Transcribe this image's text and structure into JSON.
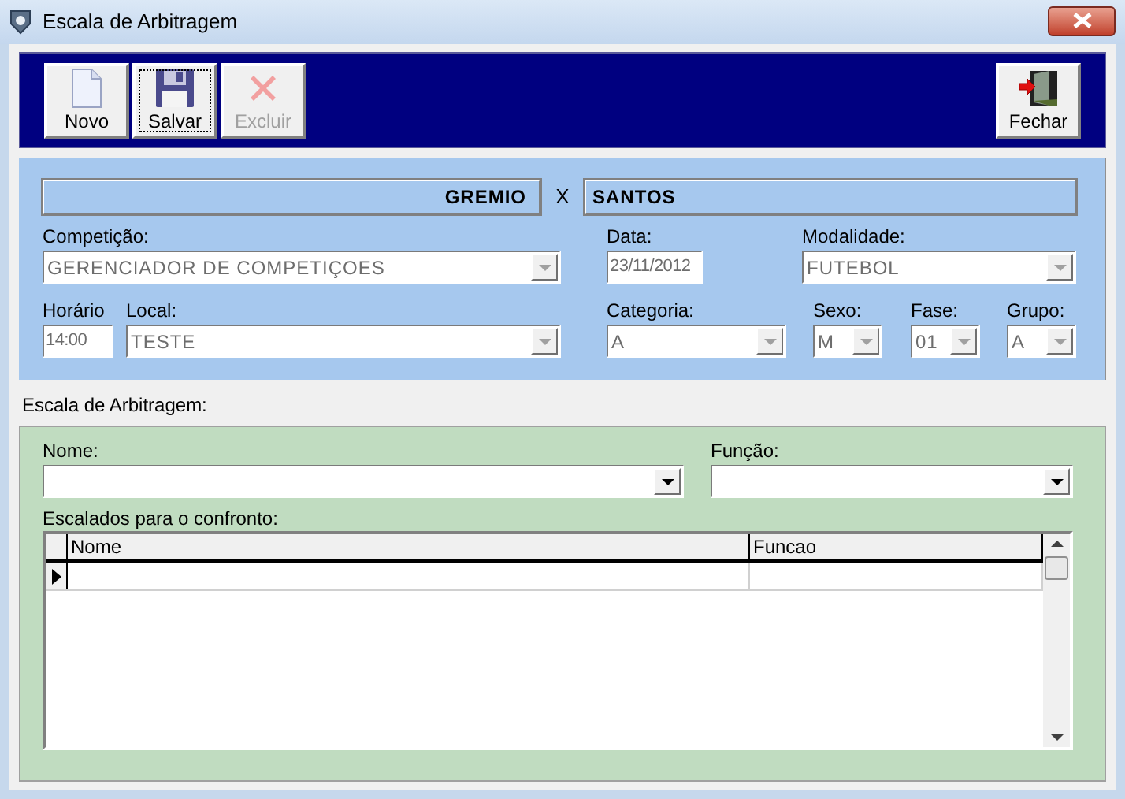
{
  "window": {
    "title": "Escala de Arbitragem"
  },
  "toolbar": {
    "buttons": [
      {
        "label": "Novo",
        "kind": "new",
        "disabled": false,
        "selected": false
      },
      {
        "label": "Salvar",
        "kind": "save",
        "disabled": false,
        "selected": true
      },
      {
        "label": "Excluir",
        "kind": "delete",
        "disabled": true,
        "selected": false
      }
    ],
    "close_button": {
      "label": "Fechar",
      "kind": "exit",
      "disabled": false,
      "selected": false
    }
  },
  "match": {
    "home": "GREMIO",
    "separator": "X",
    "away": "SANTOS"
  },
  "fields": [
    {
      "label": "Competição:",
      "value": "GERENCIADOR DE COMPETIÇOES",
      "kind": "combo",
      "disabled": true
    },
    {
      "label": "Data:",
      "value": "23/11/2012",
      "kind": "text",
      "disabled": true
    },
    {
      "label": "Modalidade:",
      "value": "FUTEBOL",
      "kind": "combo",
      "disabled": true
    },
    {
      "label": "Horário",
      "value": "14:00",
      "kind": "text",
      "disabled": true
    },
    {
      "label": "Local:",
      "value": "TESTE",
      "kind": "combo",
      "disabled": true
    },
    {
      "label": "Categoria:",
      "value": "A",
      "kind": "combo",
      "disabled": true
    },
    {
      "label": "Sexo:",
      "value": "M",
      "kind": "combo",
      "disabled": true
    },
    {
      "label": "Fase:",
      "value": "01",
      "kind": "combo",
      "disabled": true
    },
    {
      "label": "Grupo:",
      "value": "A",
      "kind": "combo",
      "disabled": true
    }
  ],
  "referees": {
    "title": "Escala de Arbitragem:",
    "fields": [
      {
        "label": "Nome:",
        "kind": "combo",
        "disabled": false
      },
      {
        "label": "Função:",
        "kind": "combo",
        "disabled": false
      }
    ],
    "grid": {
      "title": "Escalados para o confronto:",
      "columns": [
        "Nome",
        "Funcao"
      ],
      "rows": [
        {
          "selected": true
        }
      ]
    }
  }
}
